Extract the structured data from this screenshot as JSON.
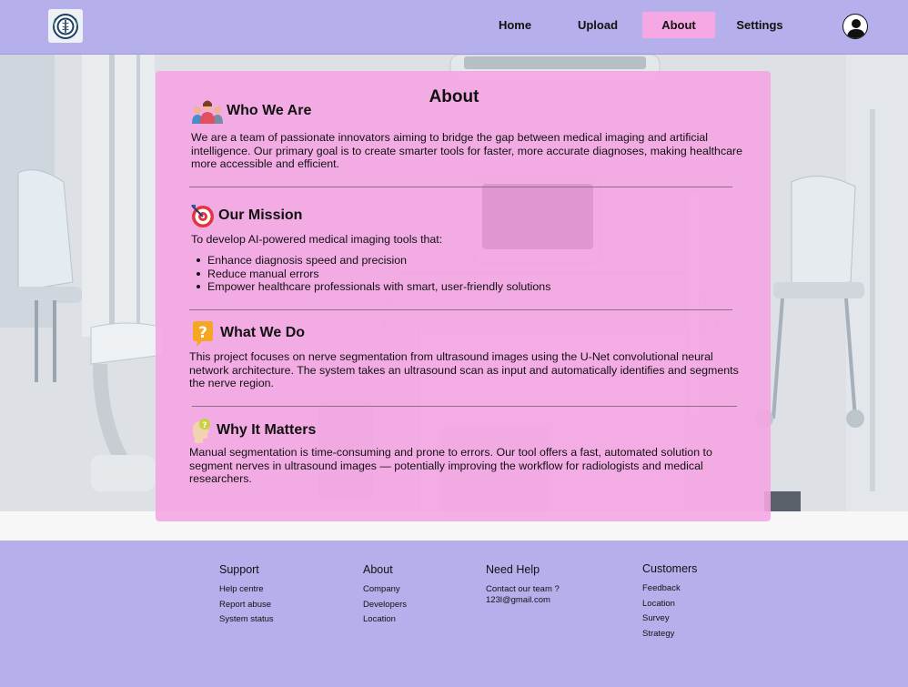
{
  "nav": {
    "home": "Home",
    "upload": "Upload",
    "about": "About",
    "settings": "Settings"
  },
  "about": {
    "title": "About",
    "sections": [
      {
        "heading": "Who We Are",
        "icon": "team-icon",
        "text": "We are a team of passionate innovators aiming to bridge the gap between medical imaging and artificial intelligence. Our primary goal is to create smarter tools for faster, more accurate diagnoses, making healthcare more accessible and efficient."
      },
      {
        "heading": "Our Mission",
        "icon": "target-icon",
        "text": "To develop AI-powered medical imaging tools that:",
        "bullets": [
          "Enhance diagnosis speed and precision",
          "Reduce manual errors",
          "Empower healthcare professionals with smart, user-friendly solutions"
        ]
      },
      {
        "heading": "What We Do",
        "icon": "question-bubble-icon",
        "text": "This project focuses on nerve segmentation from ultrasound images using the U-Net convolutional neural network architecture. The system takes an ultrasound scan as input and automatically identifies and segments the nerve region."
      },
      {
        "heading": "Why It Matters",
        "icon": "thinking-head-icon",
        "text": "Manual segmentation is time-consuming and prone to errors. Our tool offers a fast, automated solution to segment nerves in ultrasound images — potentially improving the workflow for radiologists and medical researchers."
      }
    ]
  },
  "footer": {
    "support": {
      "heading": "Support",
      "items": [
        "Help centre",
        "Report abuse",
        "System status"
      ]
    },
    "about": {
      "heading": "About",
      "items": [
        "Company",
        "Developers",
        "Location"
      ]
    },
    "help": {
      "heading": "Need Help",
      "line1": "Contact our team ?",
      "line2": "123l@gmail.com"
    },
    "customers": {
      "heading": "Customers",
      "items": [
        "Feedback",
        "Location",
        "Survey",
        "Strategy"
      ]
    }
  },
  "colors": {
    "navbar": "#b5b0ec",
    "active_tab": "#f6a8e4",
    "card": "#f6a4e2",
    "footer": "#b5b0ec"
  }
}
